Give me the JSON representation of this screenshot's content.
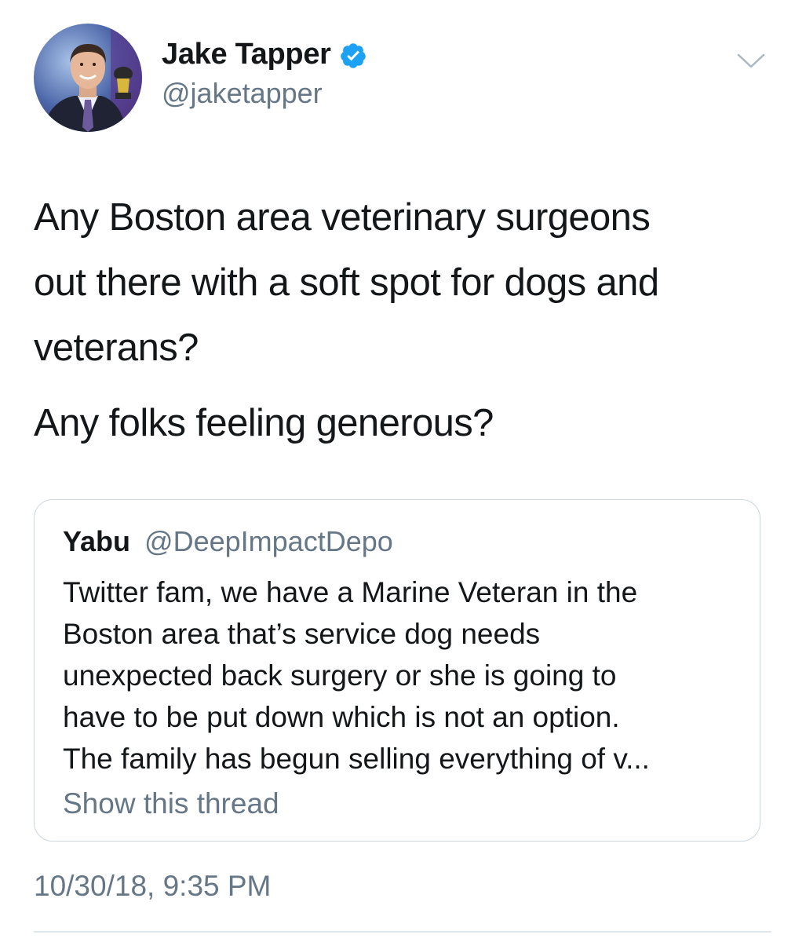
{
  "colors": {
    "text": "#14171a",
    "secondary": "#657786",
    "verified": "#1da1f2",
    "border": "#ccd6dd"
  },
  "author": {
    "display_name": "Jake Tapper",
    "handle": "@jaketapper",
    "verified": true,
    "avatar_icon": "profile-photo"
  },
  "tweet": {
    "text_lines": [
      "Any Boston area veterinary surgeons",
      "out there with a soft spot for dogs and",
      "veterans?"
    ],
    "text_paragraph_2": "Any folks feeling generous?",
    "timestamp": "10/30/18, 9:35 PM"
  },
  "quoted_tweet": {
    "display_name": "Yabu",
    "handle": "@DeepImpactDepo",
    "text_lines": [
      "Twitter fam, we have a Marine Veteran in the",
      "Boston area that’s service dog needs",
      "unexpected back surgery or she is going to",
      "have to be put down which is not an option.",
      "The family has begun selling everything of v..."
    ],
    "show_thread_label": "Show this thread"
  },
  "menu_icon": "chevron-down-icon"
}
